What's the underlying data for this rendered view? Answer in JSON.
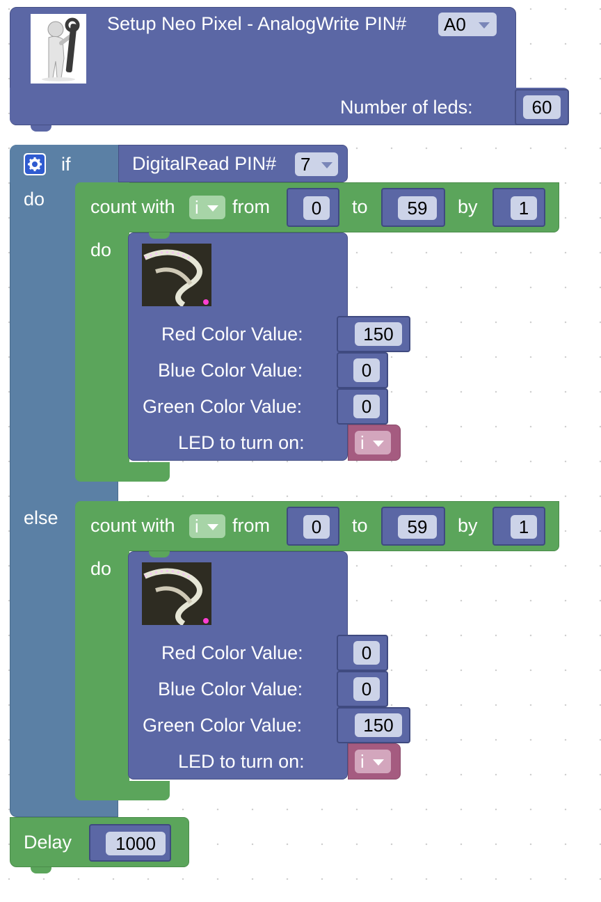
{
  "setup": {
    "title": "Setup Neo Pixel - AnalogWrite PIN#",
    "pin": "A0",
    "leds_label": "Number of leds:",
    "leds_value": "60"
  },
  "if_block": {
    "if_label": "if",
    "do_label": "do",
    "else_label": "else",
    "condition_label": "DigitalRead PIN#",
    "condition_pin": "7"
  },
  "loop_then": {
    "count_label": "count with",
    "var": "i",
    "from_label": "from",
    "from": "0",
    "to_label": "to",
    "to": "59",
    "by_label": "by",
    "by": "1",
    "do_label": "do",
    "pixel": {
      "red_label": "Red Color Value:",
      "red": "150",
      "blue_label": "Blue Color Value:",
      "blue": "0",
      "green_label": "Green Color Value:",
      "green": "0",
      "led_label": "LED to turn on:",
      "led_var": "i"
    }
  },
  "loop_else": {
    "count_label": "count with",
    "var": "i",
    "from_label": "from",
    "from": "0",
    "to_label": "to",
    "to": "59",
    "by_label": "by",
    "by": "1",
    "do_label": "do",
    "pixel": {
      "red_label": "Red Color Value:",
      "red": "0",
      "blue_label": "Blue Color Value:",
      "blue": "0",
      "green_label": "Green Color Value:",
      "green": "150",
      "led_label": "LED to turn on:",
      "led_var": "i"
    }
  },
  "delay": {
    "label": "Delay",
    "value": "1000"
  },
  "colors": {
    "setup_block": "#5b67a5",
    "if_block": "#5b80a5",
    "loop_block": "#5ba55b",
    "variable_block": "#a55b80",
    "field_bg": "#ccd3e8"
  }
}
